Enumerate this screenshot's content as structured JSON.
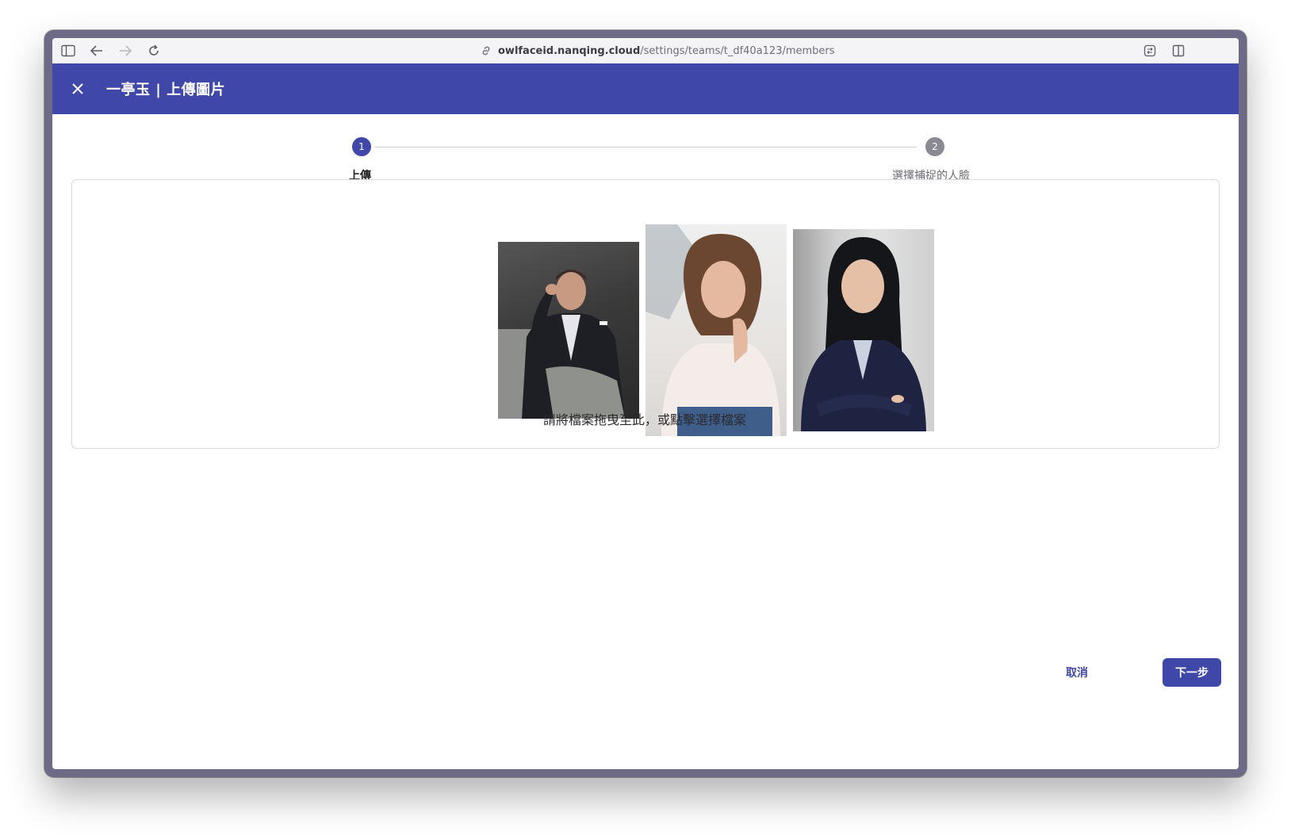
{
  "browser": {
    "url_host": "owlfaceid.nanqing.cloud",
    "url_path": "/settings/teams/t_df40a123/members",
    "icons": [
      "sidebar-toggle-icon",
      "back-arrow-icon",
      "forward-arrow-icon",
      "reload-icon",
      "link-icon",
      "extension-icon",
      "split-view-icon"
    ]
  },
  "header": {
    "title": "一亭玉 | 上傳圖片",
    "close_icon": "close-icon",
    "bg_color": "#3f47a8"
  },
  "stepper": {
    "steps": [
      {
        "number": "1",
        "label": "上傳",
        "state": "active"
      },
      {
        "number": "2",
        "label": "選擇捕捉的人臉",
        "state": "inactive"
      }
    ]
  },
  "dropzone": {
    "hint": "請將檔案拖曳至此，或點擊選擇檔案",
    "images": [
      "uploaded-photo-man",
      "uploaded-photo-woman-1",
      "uploaded-photo-woman-2"
    ]
  },
  "footer": {
    "cancel_label": "取消",
    "next_label": "下一步",
    "accent_color": "#3f47a8"
  }
}
